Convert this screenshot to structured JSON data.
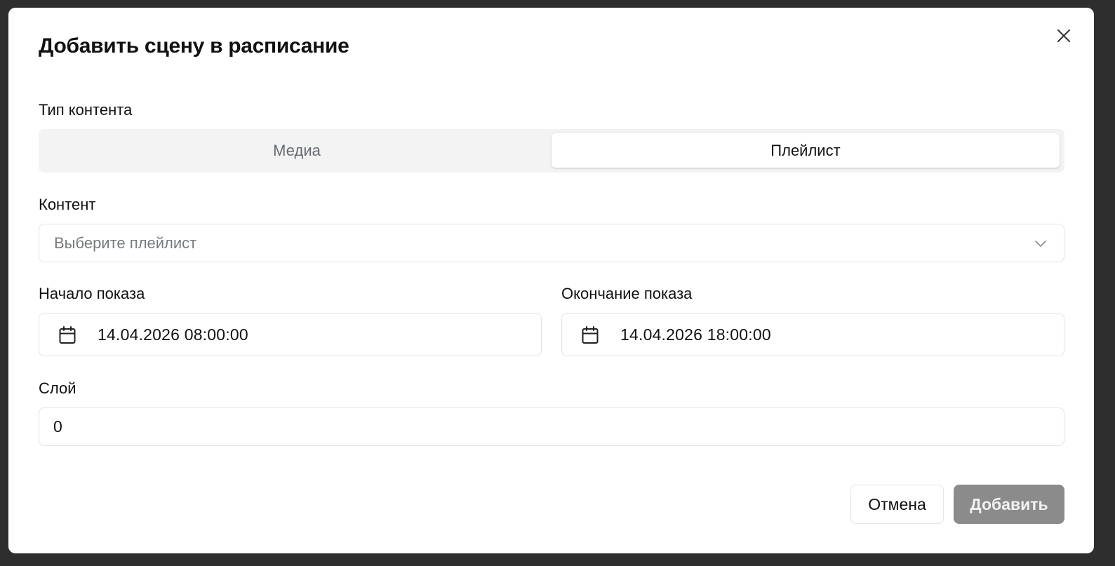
{
  "dialog": {
    "title": "Добавить сцену в расписание",
    "close_icon": "close-icon"
  },
  "content_type": {
    "label": "Тип контента",
    "options": [
      "Медиа",
      "Плейлист"
    ],
    "selected": "Плейлист"
  },
  "content": {
    "label": "Контент",
    "placeholder": "Выберите плейлист",
    "icon": "chevron-down-icon"
  },
  "start": {
    "label": "Начало показа",
    "value": "14.04.2026 08:00:00",
    "icon": "calendar-icon"
  },
  "end": {
    "label": "Окончание показа",
    "value": "14.04.2026 18:00:00",
    "icon": "calendar-icon"
  },
  "layer": {
    "label": "Слой",
    "value": "0"
  },
  "actions": {
    "cancel_label": "Отмена",
    "add_label": "Добавить"
  },
  "colors": {
    "backdrop": "#2e2e2e",
    "primary_disabled": "#8b8b8b",
    "segment_bg": "#f3f3f3"
  }
}
